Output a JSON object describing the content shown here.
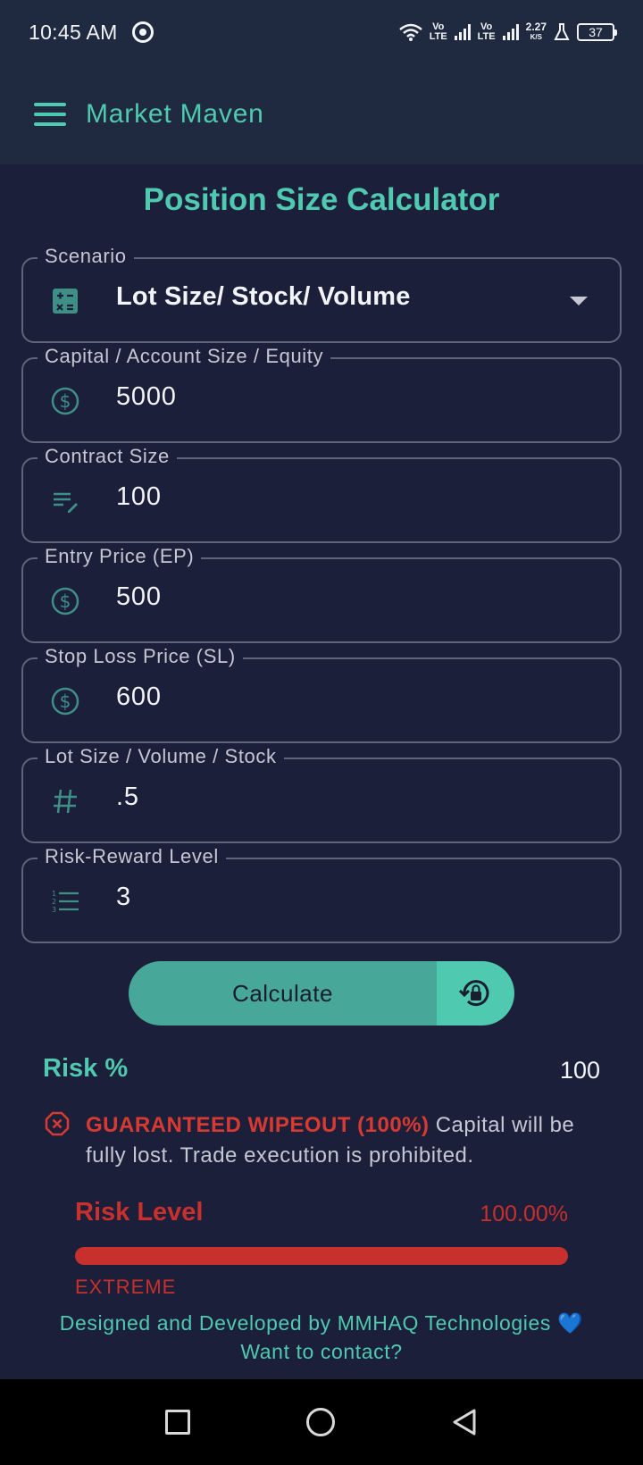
{
  "status_bar": {
    "time": "10:45 AM",
    "volte1_top": "Vo",
    "volte1_bottom": "LTE",
    "volte2_top": "Vo",
    "volte2_bottom": "LTE",
    "speed_value": "2.27",
    "speed_unit": "K/S",
    "battery": "37"
  },
  "app_bar": {
    "title": "Market Maven"
  },
  "page": {
    "title": "Position Size Calculator"
  },
  "fields": {
    "scenario": {
      "label": "Scenario",
      "value": "Lot Size/ Stock/ Volume",
      "icon": "calculator-icon"
    },
    "capital": {
      "label": "Capital / Account Size / Equity",
      "value": "5000",
      "icon": "dollar-circle-icon"
    },
    "contract": {
      "label": "Contract Size",
      "value": "100",
      "icon": "edit-list-icon"
    },
    "entry": {
      "label": "Entry Price (EP)",
      "value": "500",
      "icon": "dollar-circle-icon"
    },
    "stop_loss": {
      "label": "Stop Loss Price (SL)",
      "value": "600",
      "icon": "dollar-circle-icon"
    },
    "lot_size": {
      "label": "Lot Size / Volume / Stock",
      "value": ".5",
      "icon": "hash-icon"
    },
    "risk_reward": {
      "label": "Risk-Reward Level",
      "value": "3",
      "icon": "numbered-list-icon"
    }
  },
  "calculate": {
    "label": "Calculate",
    "lock_icon": "history-lock-icon"
  },
  "risk": {
    "label": "Risk %",
    "value": "100"
  },
  "warning": {
    "icon": "close-circle-icon",
    "strong": "GUARANTEED WIPEOUT (100%)",
    "text": " Capital will be fully lost. Trade execution is prohibited."
  },
  "risk_level": {
    "title": "Risk Level",
    "percent_text": "100.00%",
    "fill_fraction": 1.0,
    "tag": "EXTREME"
  },
  "footer": {
    "credit": "Designed and Developed by MMHAQ Technologies 💙",
    "contact": "Want to contact?"
  },
  "colors": {
    "accent": "#4fc9b0",
    "background": "#1c1f3a",
    "appbar": "#1f2a40",
    "danger": "#c7302c",
    "button": "#47a89a"
  }
}
